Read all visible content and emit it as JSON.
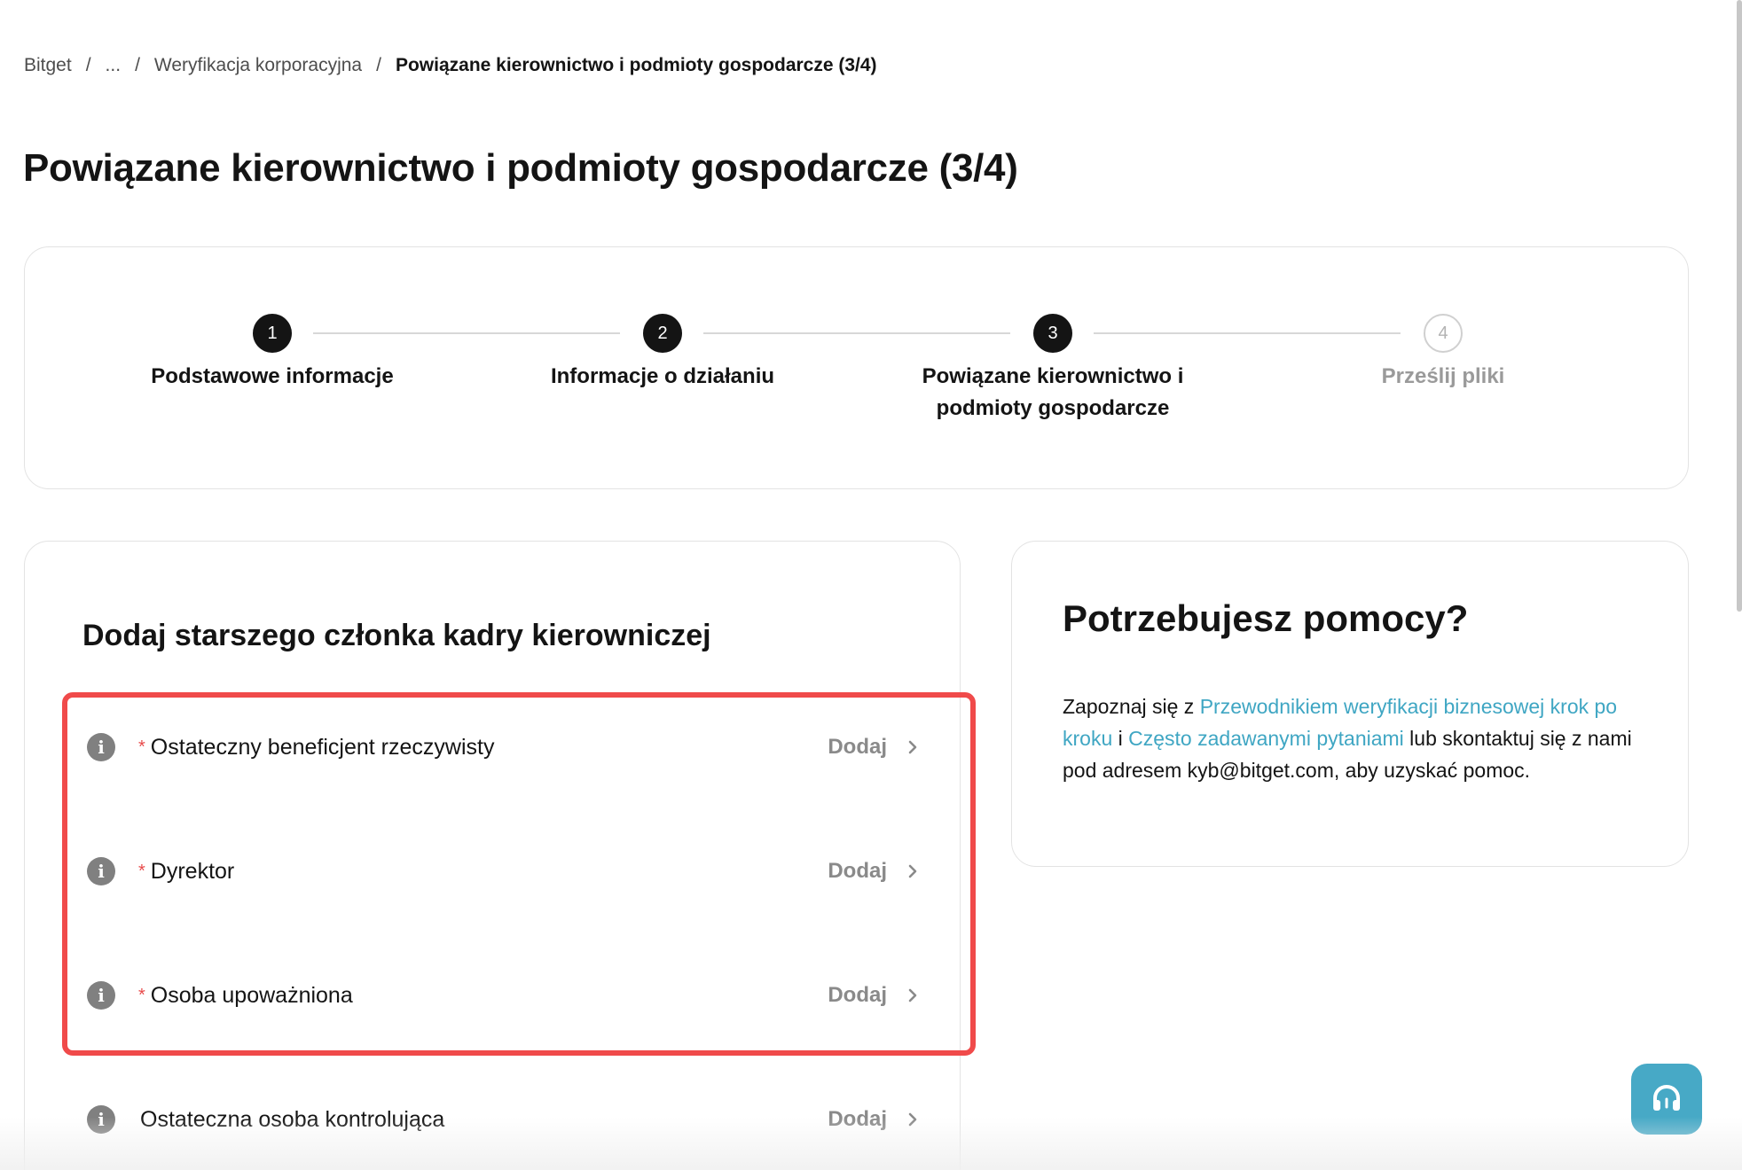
{
  "breadcrumb": {
    "root": "Bitget",
    "ellipsis": "...",
    "parent": "Weryfikacja korporacyjna",
    "current": "Powiązane kierownictwo i podmioty gospodarcze (3/4)",
    "separator": "/"
  },
  "page_title": "Powiązane kierownictwo i podmioty gospodarcze (3/4)",
  "stepper": {
    "current_step": 3,
    "steps": [
      {
        "number": "1",
        "label": "Podstawowe informacje",
        "state": "done"
      },
      {
        "number": "2",
        "label": "Informacje o działaniu",
        "state": "done"
      },
      {
        "number": "3",
        "label": "Powiązane kierownictwo i podmioty gospodarcze",
        "state": "active"
      },
      {
        "number": "4",
        "label": "Prześlij pliki",
        "state": "inactive"
      }
    ]
  },
  "form": {
    "heading": "Dodaj starszego członka kadry kierowniczej",
    "rows": [
      {
        "label": "Ostateczny beneficjent rzeczywisty",
        "required": true,
        "action": "Dodaj",
        "required_mark": "*"
      },
      {
        "label": "Dyrektor",
        "required": true,
        "action": "Dodaj",
        "required_mark": "*"
      },
      {
        "label": "Osoba upoważniona",
        "required": true,
        "action": "Dodaj",
        "required_mark": "*"
      },
      {
        "label": "Ostateczna osoba kontrolująca",
        "required": false,
        "action": "Dodaj"
      }
    ]
  },
  "help": {
    "title": "Potrzebujesz pomocy?",
    "text_prefix": "Zapoznaj się z ",
    "guide_link": "Przewodnikiem weryfikacji biznesowej krok po kroku",
    "connector": " i ",
    "faq_link": "Często zadawanymi pytaniami",
    "text_suffix": " lub skontaktuj się z nami pod adresem kyb@bitget.com, aby uzyskać pomoc."
  },
  "colors": {
    "accent_link": "#3fa6c3",
    "highlight_border": "#f04a4a",
    "support_button": "#47a9c6",
    "step_active": "#141414"
  },
  "icons": {
    "info": "info-icon",
    "chevron": "chevron-right-icon",
    "support": "headset-icon"
  }
}
